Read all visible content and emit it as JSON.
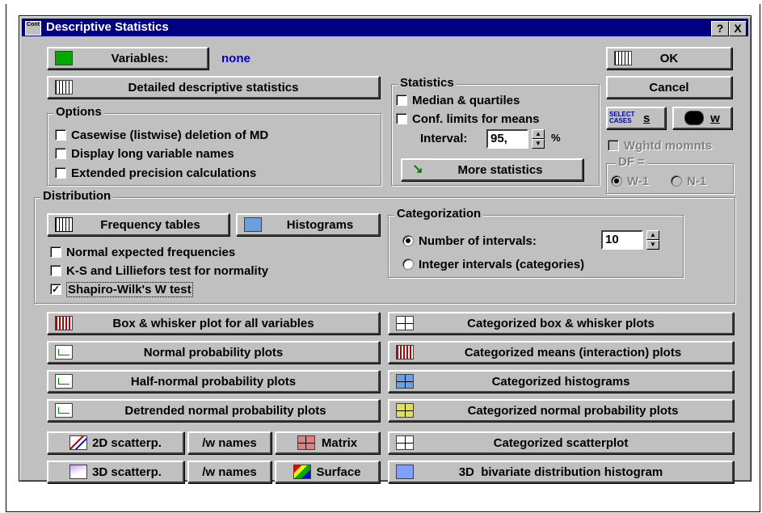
{
  "window": {
    "title": "Descriptive Statistics",
    "help_btn": "?",
    "close_btn": "X",
    "sys_icon": "stat-app-icon"
  },
  "top": {
    "variables_label": "Variables:",
    "variables_value": "none",
    "detailed_label": "Detailed descriptive statistics",
    "ok_label": "OK",
    "cancel_label": "Cancel",
    "select_cases_label": "SELECT CASES",
    "s_label": "s",
    "w_label": "w",
    "wghtd_label": "Wghtd momnts",
    "df_label": "DF =",
    "df_w1": "W-1",
    "df_n1": "N-1"
  },
  "options": {
    "title": "Options",
    "items": [
      {
        "label": "Casewise (listwise) deletion of MD",
        "checked": false
      },
      {
        "label": "Display long variable names",
        "checked": false
      },
      {
        "label": "Extended precision calculations",
        "checked": false
      }
    ]
  },
  "statistics": {
    "title": "Statistics",
    "median": {
      "label": "Median & quartiles",
      "checked": false
    },
    "conf": {
      "label": "Conf. limits for means",
      "checked": false
    },
    "interval_label": "Interval:",
    "interval_value": "95,",
    "percent": "%",
    "more_label": "More statistics"
  },
  "distribution": {
    "title": "Distribution",
    "freq_label": "Frequency tables",
    "hist_label": "Histograms",
    "items": [
      {
        "label": "Normal expected frequencies",
        "checked": false
      },
      {
        "label": "K-S and Lilliefors test for normality",
        "checked": false
      },
      {
        "label": "Shapiro-Wilk's W test",
        "checked": true
      }
    ],
    "categorization": {
      "title": "Categorization",
      "num_intervals_label": "Number of intervals:",
      "num_intervals_value": "10",
      "integer_label": "Integer intervals (categories)"
    }
  },
  "plots": {
    "box_whisker": "Box & whisker plot for all variables",
    "normal_prob": "Normal probability plots",
    "half_normal": "Half-normal probability plots",
    "detrended": "Detrended normal probability plots",
    "cat_box": "Categorized box & whisker plots",
    "cat_means": "Categorized means (interaction) plots",
    "cat_hist": "Categorized histograms",
    "cat_normal": "Categorized normal probability plots",
    "scatter2d": "2D scatterp.",
    "wnames1": "/w names",
    "matrix": "Matrix",
    "scatter3d": "3D scatterp.",
    "wnames2": "/w names",
    "surface": "Surface",
    "cat_scatter": "Categorized scatterplot",
    "bivariate": "3D  bivariate distribution histogram"
  }
}
